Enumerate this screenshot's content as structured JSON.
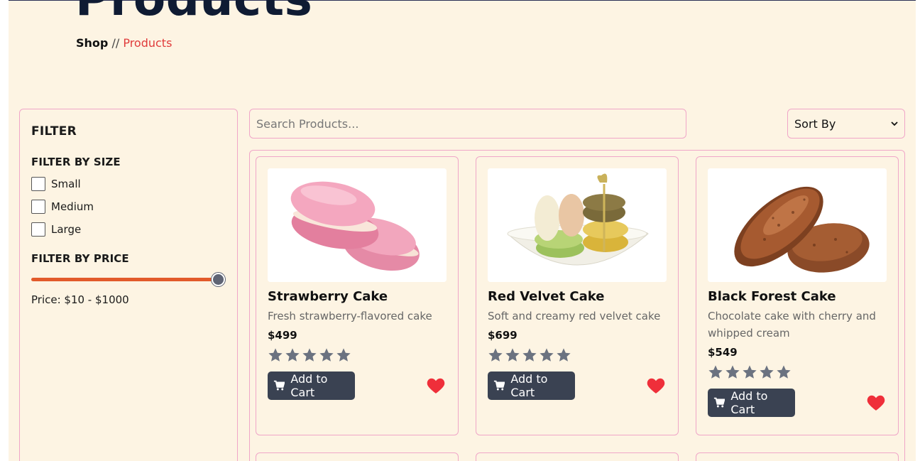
{
  "header": {
    "title": "Products",
    "breadcrumb": {
      "home": "Shop",
      "separator": "//",
      "current": "Products"
    }
  },
  "sidebar": {
    "title": "FILTER",
    "size_title": "FILTER BY SIZE",
    "sizes": [
      "Small",
      "Medium",
      "Large"
    ],
    "price_title": "FILTER BY PRICE",
    "price_text": "Price: $10 - $1000",
    "slider_value_fraction": 1.0
  },
  "toolbar": {
    "search_placeholder": "Search Products...",
    "sort_label": "Sort By"
  },
  "products": [
    {
      "name": "Strawberry Cake",
      "description": "Fresh strawberry-flavored cake",
      "price": "$499",
      "rating": 5,
      "add_label": "Add to Cart",
      "image": "pink-macarons"
    },
    {
      "name": "Red Velvet Cake",
      "description": "Soft and creamy red velvet cake",
      "price": "$699",
      "rating": 5,
      "add_label": "Add to Cart",
      "image": "macarons-bowl"
    },
    {
      "name": "Black Forest Cake",
      "description": "Chocolate cake with cherry and whipped cream",
      "price": "$549",
      "rating": 5,
      "add_label": "Add to Cart",
      "image": "bread-loaves"
    }
  ],
  "colors": {
    "background": "#fdf4e3",
    "border": "#f0a6c8",
    "accent": "#e03b3b",
    "button": "#3a4252",
    "star": "#6b7280",
    "heart": "#ef2f3a",
    "slider": "#e25a2a"
  }
}
